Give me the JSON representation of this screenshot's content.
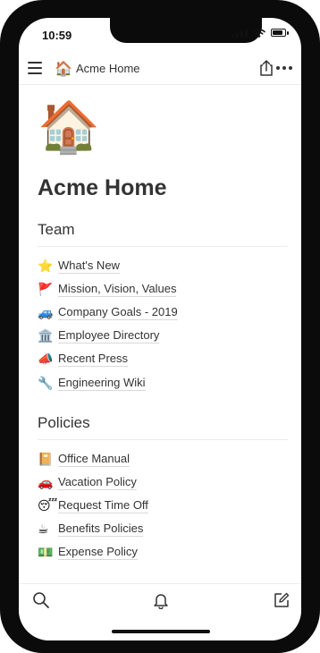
{
  "status_bar": {
    "time": "10:59"
  },
  "top_bar": {
    "page_emoji": "🏠",
    "title": "Acme Home"
  },
  "page": {
    "icon_emoji": "🏠",
    "title": "Acme Home"
  },
  "sections": [
    {
      "title": "Team",
      "items": [
        {
          "emoji": "⭐",
          "label": "What's New"
        },
        {
          "emoji": "🚩",
          "label": "Mission, Vision, Values"
        },
        {
          "emoji": "🚙",
          "label": "Company Goals - 2019"
        },
        {
          "emoji": "🏛️",
          "label": "Employee Directory"
        },
        {
          "emoji": "📣",
          "label": "Recent Press"
        },
        {
          "emoji": "🔧",
          "label": "Engineering Wiki"
        }
      ]
    },
    {
      "title": "Policies",
      "items": [
        {
          "emoji": "📔",
          "label": "Office Manual"
        },
        {
          "emoji": "🚗",
          "label": "Vacation Policy"
        },
        {
          "emoji": "😴",
          "label": "Request Time Off"
        },
        {
          "emoji": "☕",
          "label": "Benefits Policies"
        },
        {
          "emoji": "💵",
          "label": "Expense Policy"
        }
      ]
    }
  ],
  "icons": {
    "menu": "hamburger-menu-icon",
    "share": "share-icon",
    "more": "more-dots-icon",
    "search": "search-icon",
    "notifications": "bell-icon",
    "compose": "compose-icon"
  }
}
